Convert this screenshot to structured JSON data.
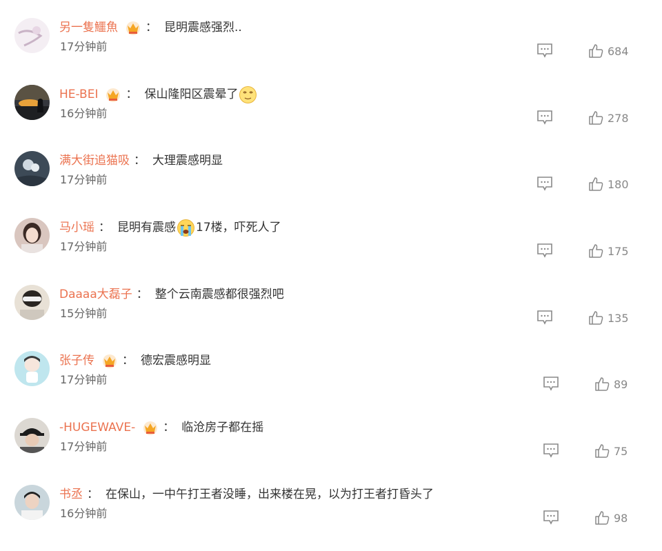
{
  "comments": [
    {
      "username": "另一隻鱷魚",
      "has_crown": true,
      "colon": "：",
      "text_parts": [
        "昆明震感强烈.."
      ],
      "emoji": null,
      "time": "17分钟前",
      "likes": "684"
    },
    {
      "username": "HE-BEI",
      "has_crown": true,
      "colon": "：",
      "text_parts": [
        "保山隆阳区震晕了"
      ],
      "emoji": "dizzy-face-emoji",
      "time": "16分钟前",
      "likes": "278"
    },
    {
      "username": "满大街追猫吸",
      "has_crown": false,
      "colon": "：",
      "text_parts": [
        "大理震感明显"
      ],
      "emoji": null,
      "time": "17分钟前",
      "likes": "180"
    },
    {
      "username": "马小瑶",
      "has_crown": false,
      "colon": "：",
      "text_parts": [
        "昆明有震感",
        "17楼，吓死人了"
      ],
      "emoji": "crying-face-emoji",
      "time": "17分钟前",
      "likes": "175"
    },
    {
      "username": "Daaaa大磊子",
      "has_crown": false,
      "colon": "：",
      "text_parts": [
        "整个云南震感都很强烈吧"
      ],
      "emoji": null,
      "time": "15分钟前",
      "likes": "135"
    },
    {
      "username": "张子传",
      "has_crown": true,
      "colon": "：",
      "text_parts": [
        "德宏震感明显"
      ],
      "emoji": null,
      "time": "17分钟前",
      "likes": "89"
    },
    {
      "username": "-HUGEWAVE-",
      "has_crown": true,
      "colon": "：",
      "text_parts": [
        "临沧房子都在摇"
      ],
      "emoji": null,
      "time": "17分钟前",
      "likes": "75"
    },
    {
      "username": "书丞",
      "has_crown": false,
      "colon": "：",
      "text_parts": [
        "在保山，一中午打王者没睡，出来楼在晃，以为打王者打昏头了"
      ],
      "emoji": null,
      "time": "16分钟前",
      "likes": "98"
    }
  ],
  "colors": {
    "username": "#eb7350",
    "text": "#333333",
    "meta": "#666666",
    "icon": "#888888"
  }
}
